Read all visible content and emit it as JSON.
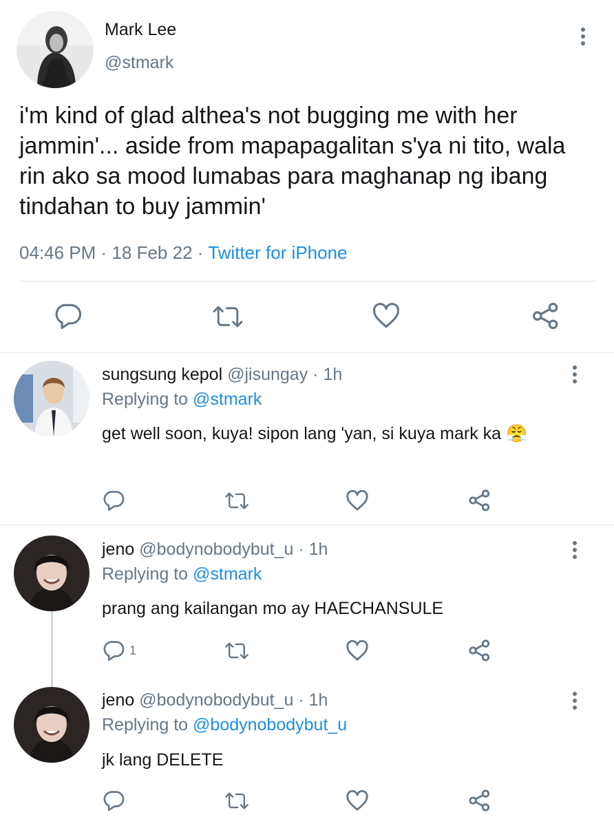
{
  "main_tweet": {
    "name": "Mark Lee",
    "handle": "@stmark",
    "text": "i'm kind of glad althea's not bugging me with her jammin'... aside from mapapagalitan s'ya ni tito, wala rin ako sa mood lumabas para maghanap ng ibang tindahan to buy jammin'",
    "time": "04:46 PM",
    "separator": "·",
    "date": "18 Feb 22",
    "source": "Twitter for iPhone"
  },
  "replies": [
    {
      "name": "sungsung kepol",
      "handle": "@jisungay",
      "sep": "·",
      "age": "1h",
      "replying_label": "Replying to",
      "replying_to": "@stmark",
      "text": "get well soon, kuya! sipon lang 'yan, si kuya mark ka",
      "emoji": "😤"
    },
    {
      "name": "jeno",
      "handle": "@bodynobodybut_u",
      "sep": "·",
      "age": "1h",
      "replying_label": "Replying to",
      "replying_to": "@stmark",
      "text": "prang ang kailangan mo ay HAECHANSULE",
      "reply_count": "1"
    },
    {
      "name": "jeno",
      "handle": "@bodynobodybut_u",
      "sep": "·",
      "age": "1h",
      "replying_label": "Replying to",
      "replying_to": "@bodynobodybut_u",
      "text": "jk lang DELETE"
    }
  ],
  "icons": {
    "reply": "reply-icon",
    "retweet": "retweet-icon",
    "like": "heart-icon",
    "share": "share-icon",
    "more": "more-vertical-icon"
  },
  "colors": {
    "text": "#14171a",
    "secondary": "#657786",
    "link": "#1d8fe1",
    "divider": "#e1e8ed"
  }
}
